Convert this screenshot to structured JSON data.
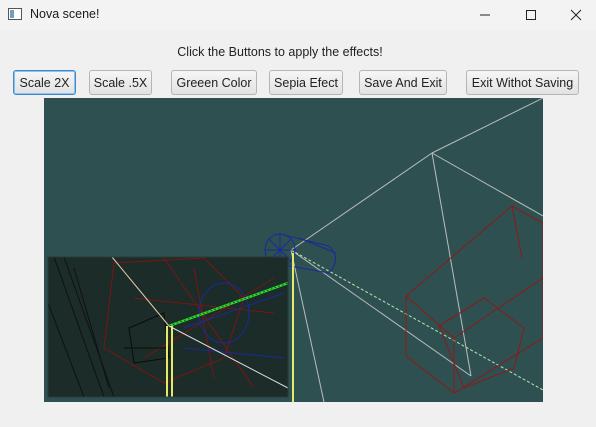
{
  "window": {
    "title": "Nova scene!"
  },
  "instructions": "Click the Buttons to apply the effects!",
  "toolbar": {
    "scale_2x_label": "Scale 2X",
    "scale_half_label": "Scale .5X",
    "green_label": "Greeen Color",
    "sepia_label": "Sepia Efect",
    "save_exit_label": "Save And Exit",
    "exit_no_save_label": "Exit Withot Saving"
  },
  "colors": {
    "viewport_bg": "#2f5050",
    "inset_bg": "#1b2c29",
    "accent_focus": "#3c8bd0"
  }
}
